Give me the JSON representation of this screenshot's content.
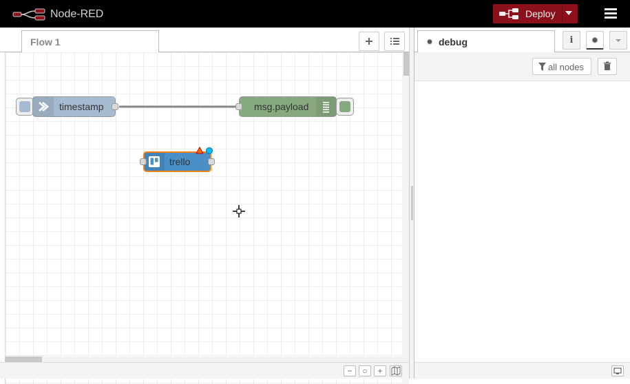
{
  "header": {
    "app_title": "Node-RED",
    "deploy_label": "Deploy"
  },
  "workspace": {
    "tabs": [
      {
        "label": "Flow 1",
        "active": true
      }
    ],
    "zoom_controls": [
      "−",
      "○",
      "+"
    ]
  },
  "nodes": {
    "inject": {
      "label": "timestamp",
      "color": "#a6bbcf"
    },
    "debug": {
      "label": "msg.payload",
      "color": "#87a980"
    },
    "trello": {
      "label": "trello",
      "color": "#4a8fc7",
      "selected_outline": "#ff7f0e",
      "status_warning": "#ff6a00",
      "status_changed": "#00bcff"
    }
  },
  "sidebar": {
    "active_tab": "debug",
    "filter_label": "all nodes"
  },
  "colors": {
    "header_bg": "#000000",
    "deploy_bg": "#8c101c",
    "wire": "#888888"
  }
}
